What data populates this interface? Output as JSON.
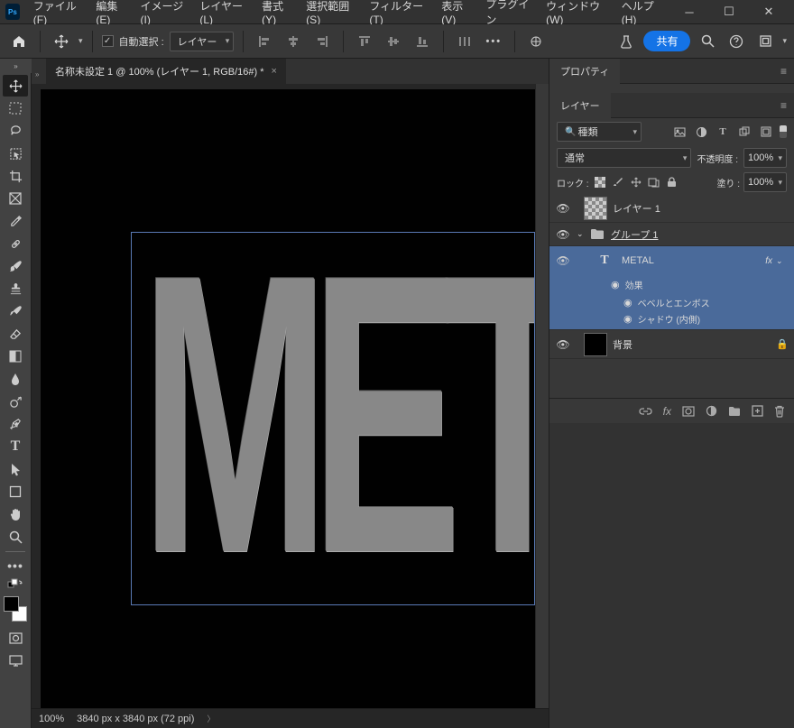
{
  "app_logo": "Ps",
  "menu": [
    "ファイル(F)",
    "編集(E)",
    "イメージ(I)",
    "レイヤー(L)",
    "書式(Y)",
    "選択範囲(S)",
    "フィルター(T)",
    "表示(V)",
    "プラグイン",
    "ウィンドウ(W)",
    "ヘルプ(H)"
  ],
  "options": {
    "auto_select_label": "自動選択 :",
    "target_dropdown": "レイヤー",
    "share_label": "共有"
  },
  "document": {
    "tab_title": "名称未設定 1 @ 100% (レイヤー 1, RGB/16#) *",
    "zoom": "100%",
    "dimensions": "3840 px x 3840 px (72 ppi)",
    "canvas_text": "META"
  },
  "panels": {
    "properties_tab": "プロパティ",
    "layers_tab": "レイヤー",
    "filter_mode": "種類",
    "blend_mode": "通常",
    "opacity_label": "不透明度 :",
    "opacity_value": "100%",
    "lock_label": "ロック :",
    "fill_label": "塗り :",
    "fill_value": "100%",
    "layers": {
      "layer1": "レイヤー 1",
      "group1": "グループ 1",
      "metal": "METAL",
      "effects": "効果",
      "bevel": "ベベルとエンボス",
      "inner_shadow": "シャドウ (内側)",
      "background": "背景"
    }
  }
}
